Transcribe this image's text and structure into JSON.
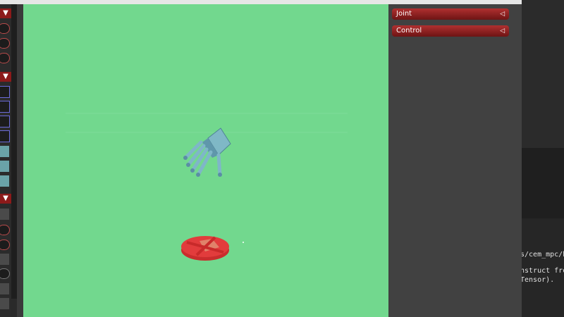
{
  "right_panel": {
    "sections": [
      {
        "label": "Joint",
        "arrow": "◁"
      },
      {
        "label": "Control",
        "arrow": "◁"
      }
    ]
  },
  "left_panel": {
    "toggle_glyph": "▼"
  },
  "terminal": {
    "lines": [
      "s/cem_mpc/b",
      "nstruct fro",
      "Tensor)."
    ]
  },
  "scene": {
    "background_color": "#72d88e",
    "target_color": "#e23c3c",
    "hand_color": "#6aa0b8"
  }
}
